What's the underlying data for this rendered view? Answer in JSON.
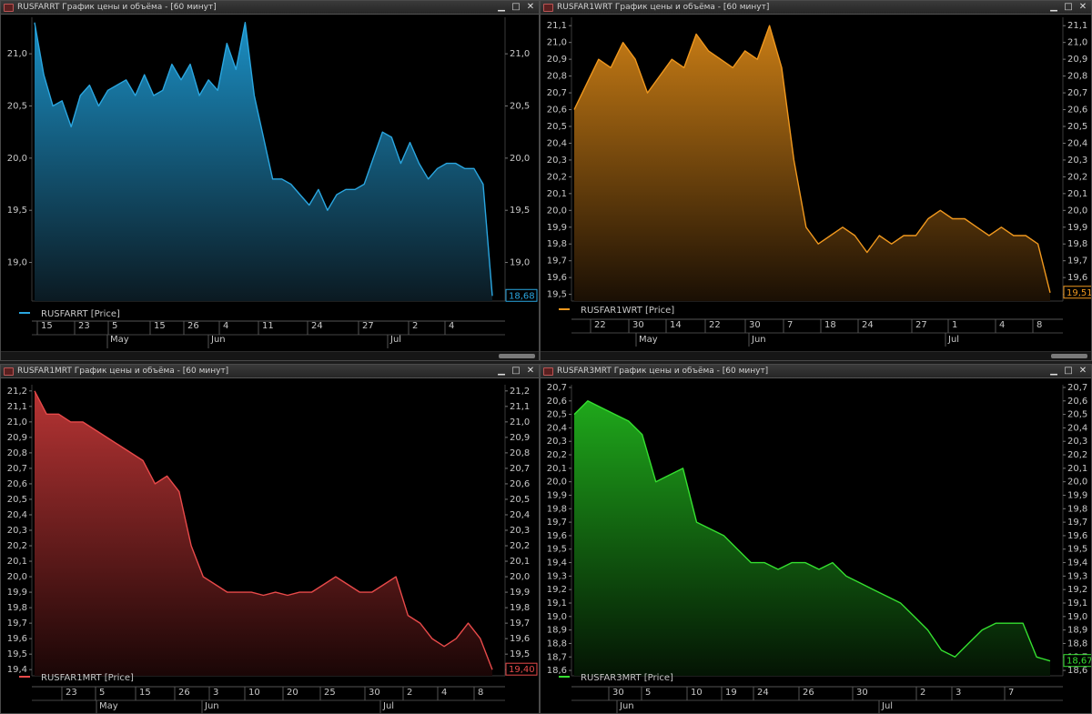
{
  "windows": [
    {
      "title": "RUSFARRT График цены и объёма - [60 минут]",
      "legend": "RUSFARRT [Price]",
      "last_label": "18,68",
      "color": "#2aa6e0",
      "fill_top": "#1b8fc4",
      "fill_bottom": "#0b1a22",
      "ticks": [
        "21,0",
        "20,5",
        "20,0",
        "19,5",
        "19,0"
      ],
      "date_labels": [
        "15",
        "23",
        "5",
        "15",
        "26",
        "4",
        "11",
        "24",
        "27",
        "2",
        "4"
      ],
      "month_labels": [
        "May",
        "Jun",
        "Jul"
      ]
    },
    {
      "title": "RUSFAR1WRT График цены и объёма - [60 минут]",
      "legend": "RUSFAR1WRT [Price]",
      "last_label": "19,51",
      "color": "#f0981e",
      "fill_top": "#c97d15",
      "fill_bottom": "#1a0f04",
      "ticks": [
        "21,1",
        "21,0",
        "20,9",
        "20,8",
        "20,7",
        "20,6",
        "20,5",
        "20,4",
        "20,3",
        "20,2",
        "20,1",
        "20,0",
        "19,9",
        "19,8",
        "19,7",
        "19,6",
        "19,5"
      ],
      "date_labels": [
        "22",
        "30",
        "14",
        "22",
        "30",
        "7",
        "18",
        "24",
        "27",
        "1",
        "4",
        "8"
      ],
      "month_labels": [
        "May",
        "Jun",
        "Jul"
      ]
    },
    {
      "title": "RUSFAR1MRT График цены и объёма - [60 минут]",
      "legend": "RUSFAR1MRT [Price]",
      "last_label": "19,40",
      "color": "#e84a4a",
      "fill_top": "#b73434",
      "fill_bottom": "#1a0606",
      "ticks": [
        "21,2",
        "21,1",
        "21,0",
        "20,9",
        "20,8",
        "20,7",
        "20,6",
        "20,5",
        "20,4",
        "20,3",
        "20,2",
        "20,1",
        "20,0",
        "19,9",
        "19,8",
        "19,7",
        "19,6",
        "19,5",
        "19,4"
      ],
      "date_labels": [
        "23",
        "5",
        "15",
        "26",
        "3",
        "10",
        "20",
        "25",
        "30",
        "2",
        "4",
        "8"
      ],
      "month_labels": [
        "May",
        "Jun",
        "Jul"
      ]
    },
    {
      "title": "RUSFAR3MRT График цены и объёма - [60 минут]",
      "legend": "RUSFAR3MRT [Price]",
      "last_label": "18,67",
      "color": "#35e030",
      "fill_top": "#1fa81b",
      "fill_bottom": "#041404",
      "ticks": [
        "20,7",
        "20,6",
        "20,5",
        "20,4",
        "20,3",
        "20,2",
        "20,1",
        "20,0",
        "19,9",
        "19,8",
        "19,7",
        "19,6",
        "19,5",
        "19,4",
        "19,3",
        "19,2",
        "19,1",
        "19,0",
        "18,9",
        "18,8",
        "18,7",
        "18,6"
      ],
      "date_labels": [
        "30",
        "5",
        "10",
        "19",
        "24",
        "26",
        "30",
        "2",
        "3",
        "7"
      ],
      "month_labels": [
        "Jun",
        "Jul"
      ]
    }
  ],
  "chart_data": [
    {
      "type": "area",
      "ylim": [
        18.63,
        21.35
      ],
      "x_positions": [
        44,
        85,
        122,
        168,
        205,
        244,
        287,
        341,
        397,
        452,
        492
      ],
      "month_positions": [
        127,
        238,
        435
      ],
      "y": [
        21.3,
        20.8,
        20.5,
        20.55,
        20.3,
        20.6,
        20.7,
        20.5,
        20.65,
        20.7,
        20.75,
        20.6,
        20.8,
        20.6,
        20.65,
        20.9,
        20.75,
        20.9,
        20.6,
        20.75,
        20.65,
        21.1,
        20.85,
        21.3,
        20.6,
        20.2,
        19.8,
        19.8,
        19.75,
        19.65,
        19.55,
        19.7,
        19.5,
        19.65,
        19.7,
        19.7,
        19.75,
        20.0,
        20.25,
        20.2,
        19.95,
        20.15,
        19.95,
        19.8,
        19.9,
        19.95,
        19.95,
        19.9,
        19.9,
        19.75,
        18.68
      ]
    },
    {
      "type": "area",
      "ylim": [
        19.46,
        21.15
      ],
      "x_positions": [
        652,
        694,
        735,
        778,
        822,
        864,
        905,
        946,
        1005,
        1045,
        1097,
        1138
      ],
      "month_positions": [
        708,
        832,
        1048
      ],
      "y": [
        20.6,
        20.75,
        20.9,
        20.85,
        21.0,
        20.9,
        20.7,
        20.8,
        20.9,
        20.85,
        21.05,
        20.95,
        20.9,
        20.85,
        20.95,
        20.9,
        21.1,
        20.85,
        20.3,
        19.9,
        19.8,
        19.85,
        19.9,
        19.85,
        19.75,
        19.85,
        19.8,
        19.85,
        19.85,
        19.95,
        20.0,
        19.95,
        19.95,
        19.9,
        19.85,
        19.9,
        19.85,
        19.85,
        19.8,
        19.51
      ]
    },
    {
      "type": "area",
      "ylim": [
        19.36,
        21.24
      ],
      "x_positions": [
        71,
        108,
        152,
        195,
        233,
        272,
        314,
        355,
        404,
        446,
        484,
        524
      ],
      "month_positions": [
        115,
        231,
        427
      ],
      "y": [
        21.2,
        21.05,
        21.05,
        21.0,
        21.0,
        20.95,
        20.9,
        20.85,
        20.8,
        20.75,
        20.6,
        20.65,
        20.55,
        20.2,
        20.0,
        19.95,
        19.9,
        19.9,
        19.9,
        19.88,
        19.9,
        19.88,
        19.9,
        19.9,
        19.95,
        20.0,
        19.95,
        19.9,
        19.9,
        19.95,
        20.0,
        19.75,
        19.7,
        19.6,
        19.55,
        19.6,
        19.7,
        19.6,
        19.4
      ]
    },
    {
      "type": "area",
      "ylim": [
        18.56,
        20.72
      ],
      "x_positions": [
        672,
        708,
        758,
        796,
        831,
        881,
        940,
        1010,
        1049,
        1107
      ],
      "month_positions": [
        687,
        975
      ],
      "y": [
        20.5,
        20.6,
        20.55,
        20.5,
        20.45,
        20.35,
        20.0,
        20.05,
        20.1,
        19.7,
        19.65,
        19.6,
        19.5,
        19.4,
        19.4,
        19.35,
        19.4,
        19.4,
        19.35,
        19.4,
        19.3,
        19.25,
        19.2,
        19.15,
        19.1,
        19.0,
        18.9,
        18.75,
        18.7,
        18.8,
        18.9,
        18.95,
        18.95,
        18.95,
        18.7,
        18.67
      ]
    }
  ]
}
